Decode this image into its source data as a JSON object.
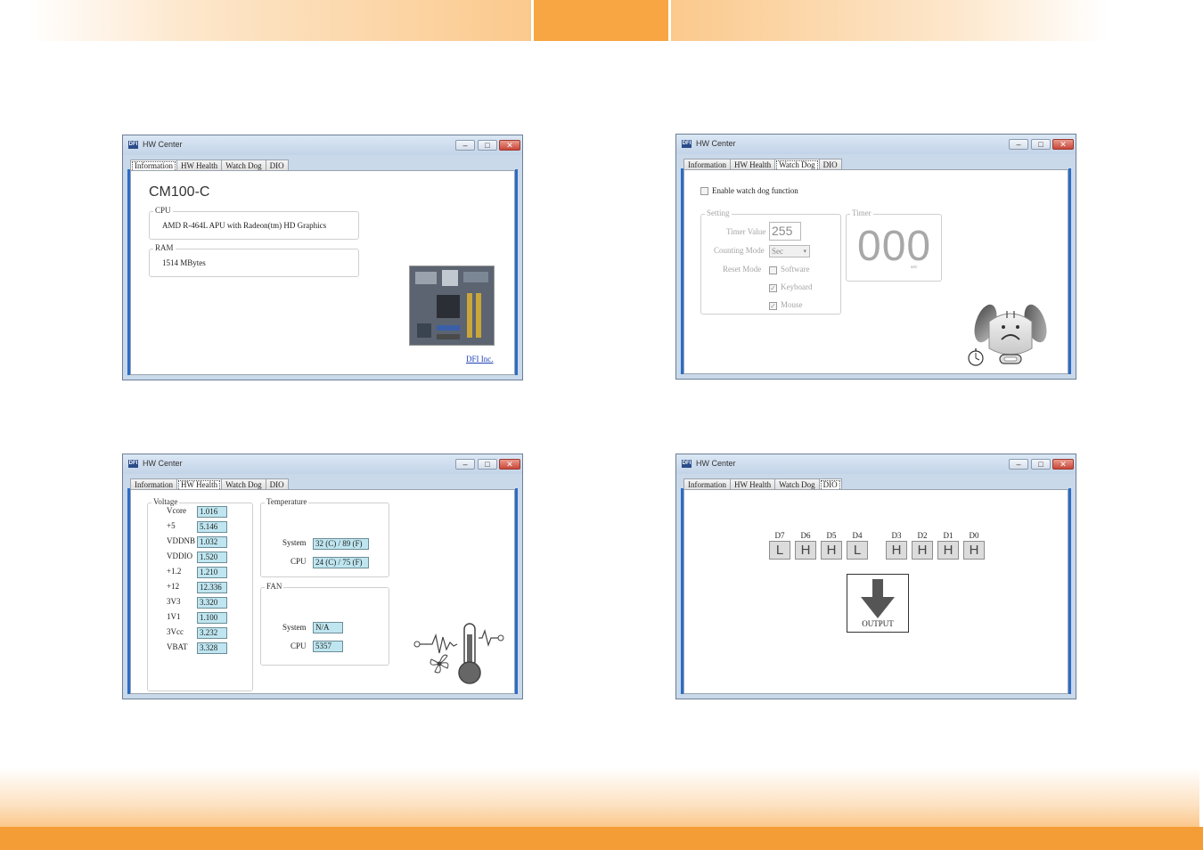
{
  "window_title": "HW Center",
  "logo_text": "DFI",
  "tabs": [
    "Information",
    "HW Health",
    "Watch Dog",
    "DIO"
  ],
  "controls": {
    "minimize": "–",
    "maximize": "□",
    "close": "✕"
  },
  "information": {
    "model": "CM100-C",
    "cpu_label": "CPU",
    "cpu_value": "AMD R-464L APU with Radeon(tm) HD Graphics",
    "ram_label": "RAM",
    "ram_value": "1514 MBytes",
    "link": "DFI Inc."
  },
  "hw_health": {
    "voltage_label": "Voltage",
    "voltages": [
      {
        "name": "Vcore",
        "value": "1.016"
      },
      {
        "name": "+5",
        "value": "5.146"
      },
      {
        "name": "VDDNB",
        "value": "1.032"
      },
      {
        "name": "VDDIO",
        "value": "1.520"
      },
      {
        "name": "+1.2",
        "value": "1.210"
      },
      {
        "name": "+12",
        "value": "12.336"
      },
      {
        "name": "3V3",
        "value": "3.320"
      },
      {
        "name": "1V1",
        "value": "1.100"
      },
      {
        "name": "3Vcc",
        "value": "3.232"
      },
      {
        "name": "VBAT",
        "value": "3.328"
      }
    ],
    "temperature_label": "Temperature",
    "temperatures": [
      {
        "name": "System",
        "value": "32 (C) / 89 (F)"
      },
      {
        "name": "CPU",
        "value": "24 (C) / 75 (F)"
      }
    ],
    "fan_label": "FAN",
    "fans": [
      {
        "name": "System",
        "value": "N/A"
      },
      {
        "name": "CPU",
        "value": "5357"
      }
    ]
  },
  "watchdog": {
    "enable_label": "Enable watch dog function",
    "enabled": false,
    "setting_label": "Setting",
    "timer_value_label": "Timer Value",
    "timer_value": "255",
    "counting_mode_label": "Counting Mode",
    "counting_mode": "Sec",
    "reset_mode_label": "Reset Mode",
    "reset_options": [
      {
        "label": "Software",
        "checked": false
      },
      {
        "label": "Keyboard",
        "checked": true
      },
      {
        "label": "Mouse",
        "checked": true
      }
    ],
    "timer_label": "Timer",
    "timer_display": "000",
    "timer_unit": "sec"
  },
  "dio": {
    "pins": [
      {
        "label": "D7",
        "state": "L"
      },
      {
        "label": "D6",
        "state": "H"
      },
      {
        "label": "D5",
        "state": "H"
      },
      {
        "label": "D4",
        "state": "L"
      },
      {
        "label": "D3",
        "state": "H"
      },
      {
        "label": "D2",
        "state": "H"
      },
      {
        "label": "D1",
        "state": "H"
      },
      {
        "label": "D0",
        "state": "H"
      }
    ],
    "output_label": "OUTPUT"
  },
  "colors": {
    "accent_orange": "#f7a643",
    "field_cyan": "#bfe6f0",
    "link_blue": "#1a3fb6"
  }
}
